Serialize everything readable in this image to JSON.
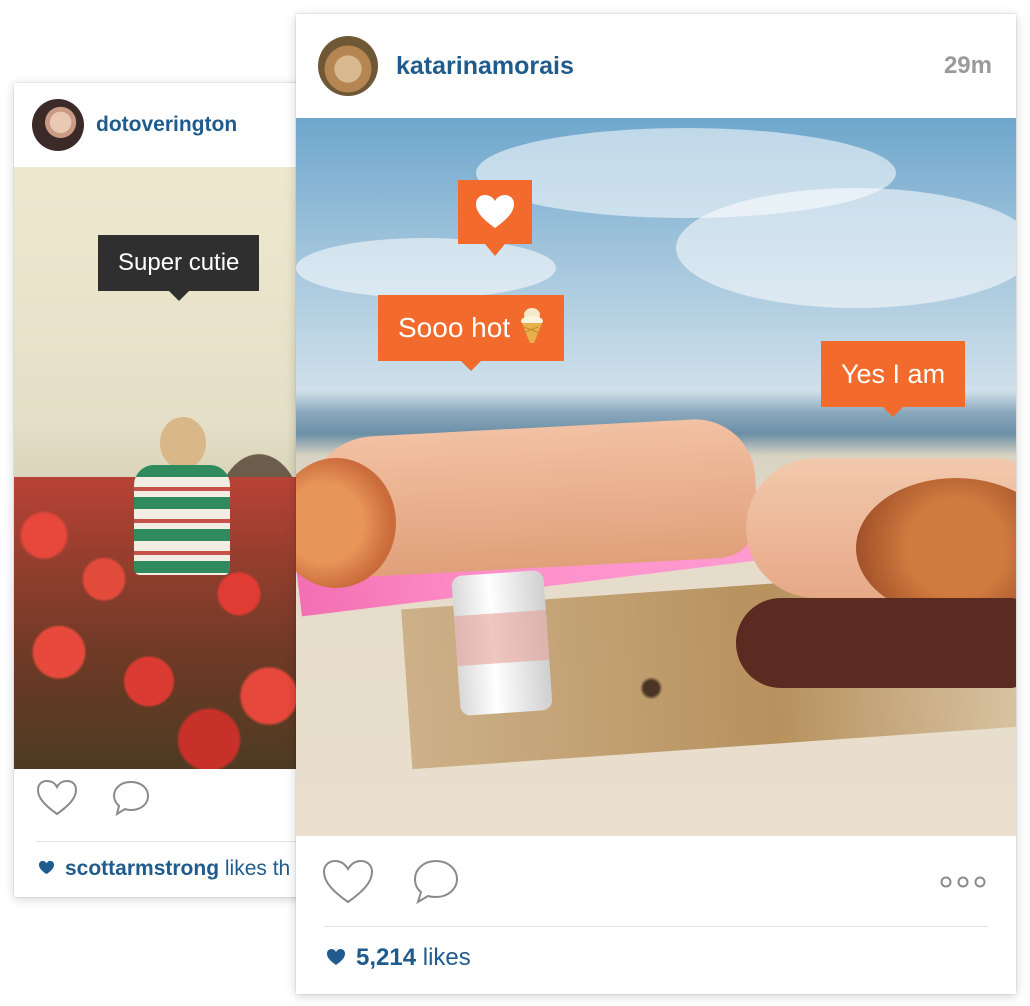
{
  "back_post": {
    "username": "dotoverington",
    "tag_text": "Super cutie",
    "liked_by": "scottarmstrong",
    "likes_suffix": "likes th"
  },
  "front_post": {
    "username": "katarinamorais",
    "time": "29m",
    "tags": {
      "tag1": "Sooo hot",
      "tag2": "Yes I am"
    },
    "likes_count": "5,214",
    "likes_word": "likes"
  },
  "colors": {
    "accent": "#f26a2c",
    "link": "#1f5b8d",
    "tag_dark": "#2f2f2f"
  },
  "icons": [
    "heart-icon",
    "comment-icon",
    "more-icon",
    "ice-cream-icon"
  ]
}
